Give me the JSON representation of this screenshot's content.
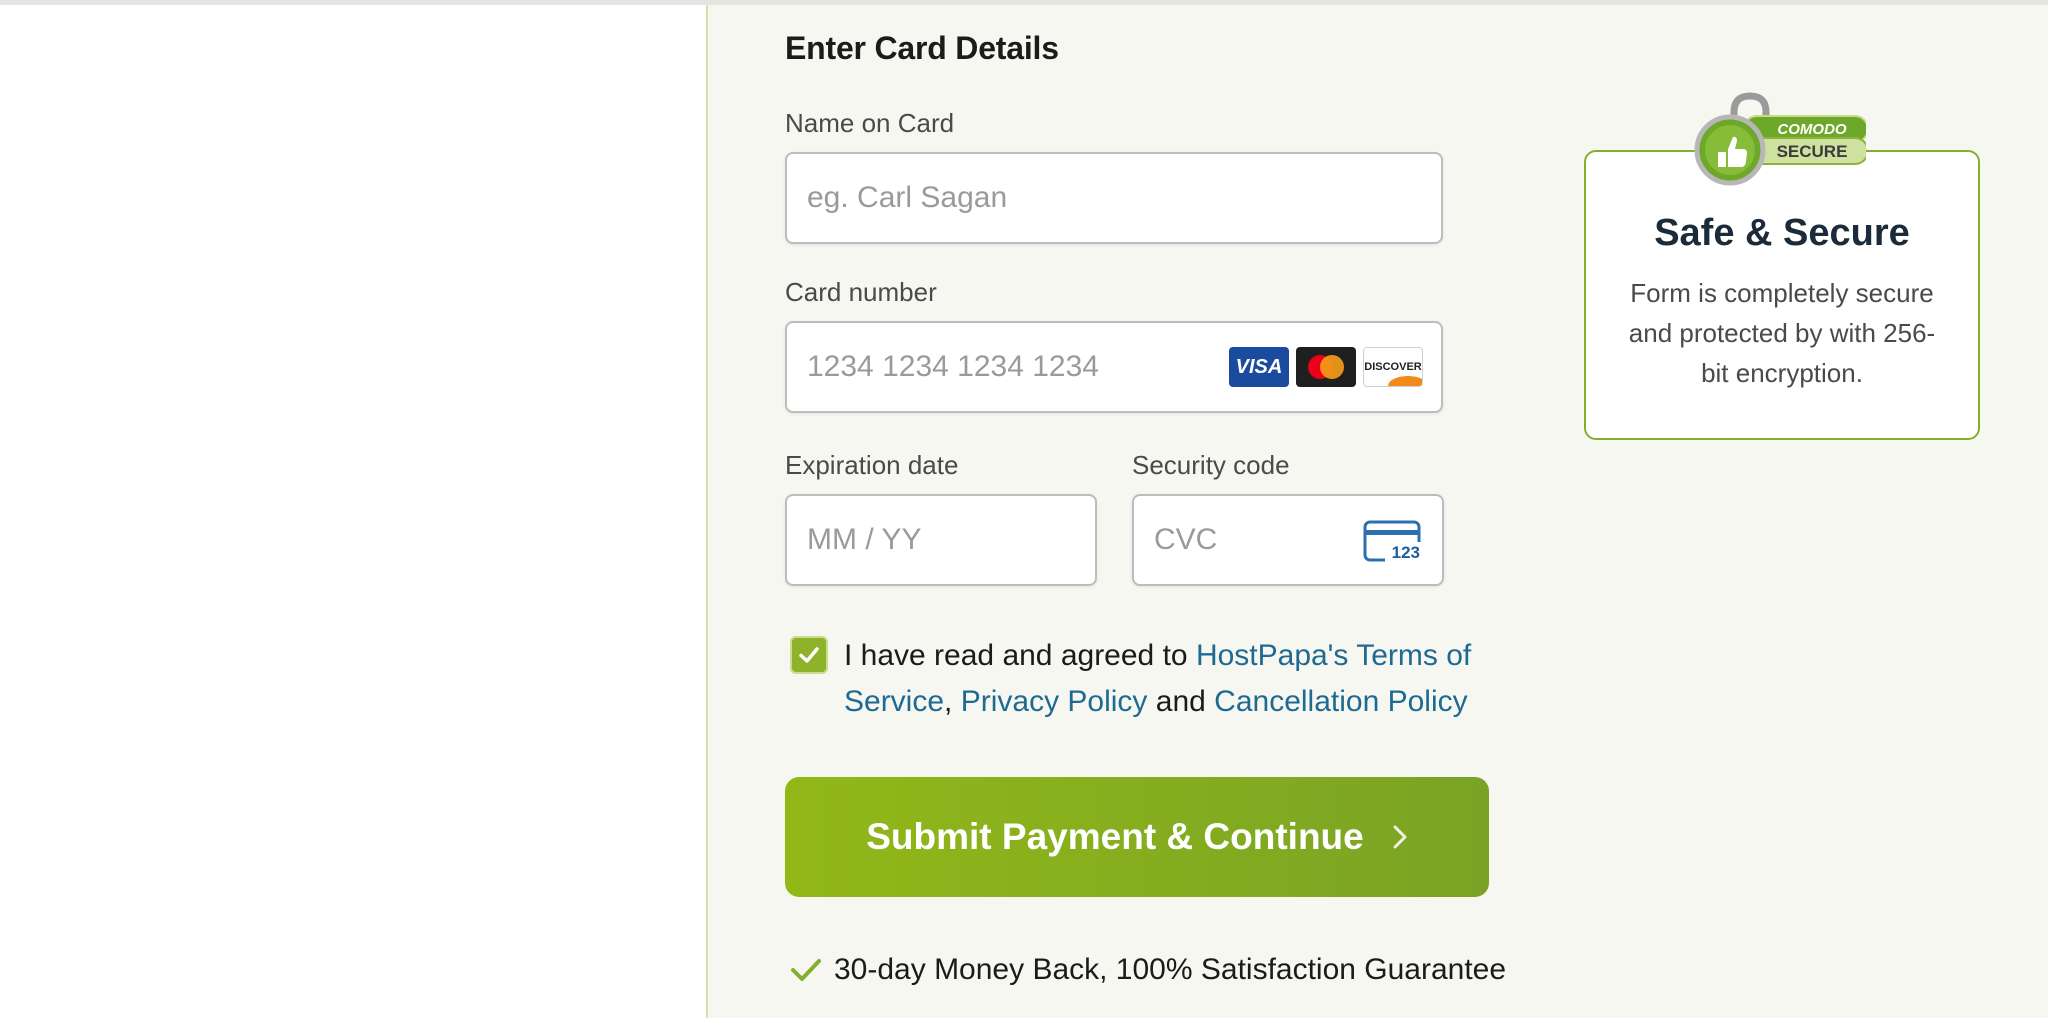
{
  "form": {
    "title": "Enter Card Details",
    "name_label": "Name on Card",
    "name_placeholder": "eg. Carl Sagan",
    "card_label": "Card number",
    "card_placeholder": "1234 1234 1234 1234",
    "card_brands": [
      "VISA",
      "Mastercard",
      "DISCOVER"
    ],
    "expiry_label": "Expiration date",
    "expiry_placeholder": "MM / YY",
    "cvc_label": "Security code",
    "cvc_placeholder": "CVC",
    "cvc_icon_text": "123"
  },
  "consent": {
    "checked": true,
    "prefix": "I have read and agreed to ",
    "terms_link": "HostPapa's Terms of Service",
    "comma": ", ",
    "privacy_link": "Privacy Policy",
    "and": " and ",
    "cancellation_link": "Cancellation Policy"
  },
  "submit": {
    "label": "Submit Payment & Continue"
  },
  "guarantee": {
    "text": "30-day Money Back, 100% Satisfaction Guarantee"
  },
  "secure": {
    "badge_top": "COMODO",
    "badge_bottom": "SECURE",
    "title": "Safe & Secure",
    "text": "Form is completely secure and protected by with 256-bit encryption."
  },
  "colors": {
    "accent_green": "#8fb22b",
    "link_blue": "#1e6a92",
    "pane_bg": "#f6f7f1"
  }
}
